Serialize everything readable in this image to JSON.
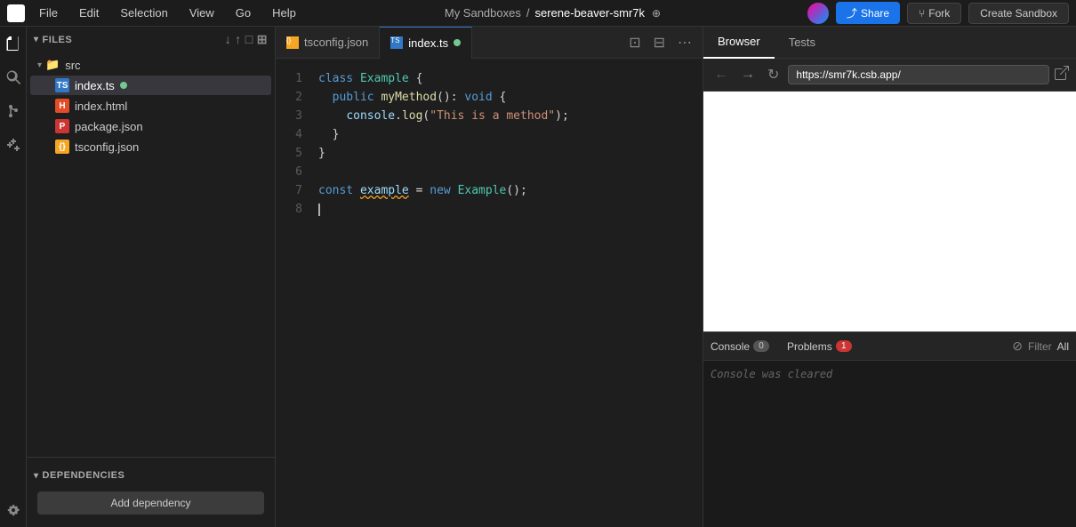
{
  "menubar": {
    "items": [
      "File",
      "Edit",
      "Selection",
      "View",
      "Go",
      "Help"
    ],
    "sandbox_path": "My Sandboxes",
    "separator": "/",
    "sandbox_name": "serene-beaver-smr7k",
    "share_label": "Share",
    "fork_label": "Fork",
    "create_sandbox_label": "Create Sandbox"
  },
  "sidebar": {
    "files_section_label": "Files",
    "src_folder": "src",
    "files": [
      {
        "name": "index.ts",
        "type": "ts",
        "modified": true,
        "active": true
      },
      {
        "name": "index.html",
        "type": "html",
        "modified": false,
        "active": false
      },
      {
        "name": "package.json",
        "type": "pkg",
        "modified": false,
        "active": false
      },
      {
        "name": "tsconfig.json",
        "type": "json",
        "modified": false,
        "active": false
      }
    ],
    "dependencies_label": "Dependencies",
    "add_dependency_label": "Add dependency"
  },
  "editor": {
    "tabs": [
      {
        "name": "tsconfig.json",
        "type": "json",
        "active": false,
        "modified": false
      },
      {
        "name": "index.ts",
        "type": "ts",
        "active": true,
        "modified": true
      }
    ],
    "code_lines": [
      "class Example {",
      "  public myMethod(): void {",
      "    console.log(\"This is a method\");",
      "  }",
      "}",
      "",
      "const example = new Example();",
      ""
    ]
  },
  "right_panel": {
    "browser_tab_label": "Browser",
    "tests_tab_label": "Tests",
    "url": "https://smr7k.csb.app/",
    "console_label": "Console",
    "console_count": "0",
    "problems_label": "Problems",
    "problems_count": "1",
    "filter_label": "Filter",
    "all_label": "All",
    "console_cleared_message": "Console was cleared"
  },
  "icons": {
    "chevron_down": "▾",
    "chevron_right": "▸",
    "back": "←",
    "forward": "→",
    "refresh": "↻",
    "external": "⬡",
    "share_icon": "⤴",
    "fork_icon": "⑂",
    "clear": "⊘",
    "globe": "⊕"
  }
}
